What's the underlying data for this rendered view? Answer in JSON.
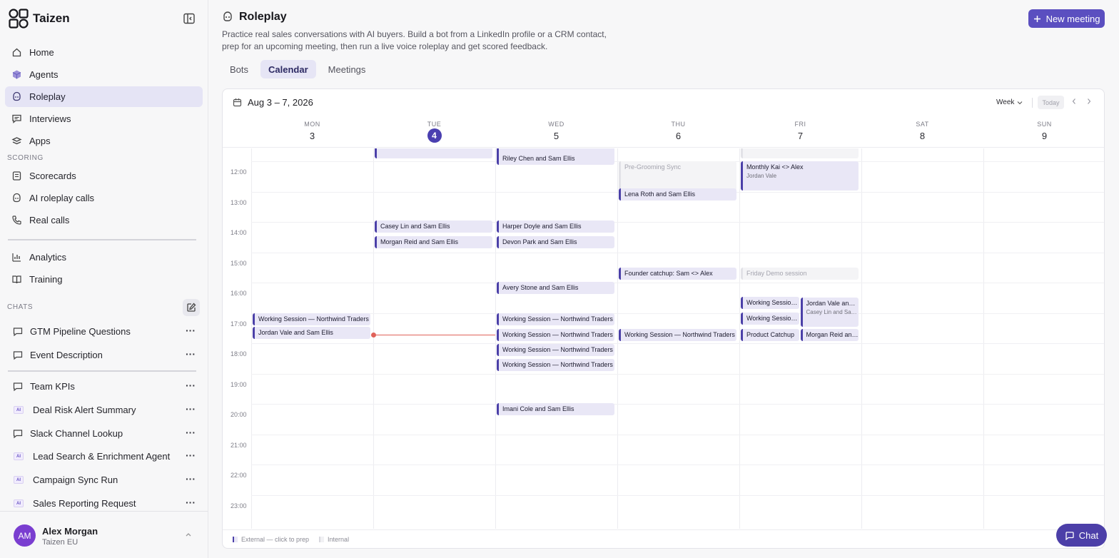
{
  "app": {
    "name": "Taizen"
  },
  "sidebar": {
    "nav": [
      {
        "label": "Home",
        "icon": "home-icon"
      },
      {
        "label": "Agents",
        "icon": "cube-icon"
      },
      {
        "label": "Roleplay",
        "icon": "roleplay-icon",
        "active": true
      },
      {
        "label": "Interviews",
        "icon": "message-icon"
      },
      {
        "label": "Apps",
        "icon": "apps-icon"
      }
    ],
    "scoring_label": "SCORING",
    "scoring": [
      {
        "label": "Scorecards",
        "icon": "scorecard-icon"
      },
      {
        "label": "AI roleplay calls",
        "icon": "ai-call-icon"
      },
      {
        "label": "Real calls",
        "icon": "phone-icon"
      }
    ],
    "tools": [
      {
        "label": "Analytics",
        "icon": "bar-chart-icon"
      },
      {
        "label": "Training",
        "icon": "training-icon"
      }
    ],
    "chats_label": "CHATS",
    "chats_top": [
      {
        "label": "GTM Pipeline Questions",
        "type": "chat"
      },
      {
        "label": "Event Description",
        "type": "chat"
      }
    ],
    "chats_bottom": [
      {
        "label": "Team KPIs",
        "type": "chat"
      },
      {
        "label": "Deal Risk Alert Summary",
        "type": "ai"
      },
      {
        "label": "Slack Channel Lookup",
        "type": "chat"
      },
      {
        "label": "Lead Search & Enrichment Agent",
        "type": "ai"
      },
      {
        "label": "Campaign Sync Run",
        "type": "ai"
      },
      {
        "label": "Sales Reporting Request",
        "type": "ai"
      }
    ],
    "ai_badge": "AI",
    "user": {
      "initials": "AM",
      "name": "Alex Morgan",
      "org": "Taizen EU"
    }
  },
  "main": {
    "title": "Roleplay",
    "description": "Practice real sales conversations with AI buyers. Build a bot from a LinkedIn profile or a CRM contact, prep for an upcoming meeting, then run a live voice roleplay and get scored feedback.",
    "new_meeting_label": "New meeting",
    "tabs": [
      {
        "label": "Bots"
      },
      {
        "label": "Calendar",
        "active": true
      },
      {
        "label": "Meetings"
      }
    ],
    "calendar": {
      "range": "Aug 3 – 7, 2026",
      "view": "Week",
      "today_label": "Today",
      "days": [
        {
          "name": "MON",
          "num": "3"
        },
        {
          "name": "TUE",
          "num": "4",
          "today": true
        },
        {
          "name": "WED",
          "num": "5"
        },
        {
          "name": "THU",
          "num": "6"
        },
        {
          "name": "FRI",
          "num": "7"
        },
        {
          "name": "SAT",
          "num": "8"
        },
        {
          "name": "SUN",
          "num": "9"
        }
      ],
      "hours": [
        "12:00",
        "13:00",
        "14:00",
        "15:00",
        "16:00",
        "17:00",
        "18:00",
        "19:00",
        "20:00",
        "21:00",
        "22:00",
        "23:00"
      ],
      "now": {
        "day": 1,
        "time": 17.72
      },
      "events": [
        {
          "day": 1,
          "start": 11.5,
          "title": "",
          "kind": "external",
          "lane": 0,
          "lanes": 1
        },
        {
          "day": 2,
          "start": 11.5,
          "title": "",
          "kind": "external",
          "lane": 0,
          "lanes": 1
        },
        {
          "day": 2,
          "start": 11.72,
          "title": "Riley Chen and Sam Ellis",
          "kind": "external",
          "lane": 0,
          "lanes": 1
        },
        {
          "day": 4,
          "start": 11.5,
          "title": "",
          "kind": "internal",
          "lane": 0,
          "lanes": 1
        },
        {
          "day": 3,
          "start": 12.0,
          "title": "Pre-Grooming Sync",
          "kind": "internal",
          "tall": true,
          "lane": 0,
          "lanes": 1
        },
        {
          "day": 4,
          "start": 12.0,
          "title": "Monthly Kai <> Alex",
          "sub": "Jordan Vale",
          "kind": "external",
          "tall": true,
          "lane": 0,
          "lanes": 1
        },
        {
          "day": 3,
          "start": 12.9,
          "title": "Lena Roth and Sam Ellis",
          "kind": "external",
          "lane": 0,
          "lanes": 1
        },
        {
          "day": 1,
          "start": 13.95,
          "title": "Casey Lin and Sam Ellis",
          "kind": "external",
          "lane": 0,
          "lanes": 1
        },
        {
          "day": 2,
          "start": 13.95,
          "title": "Harper Doyle and Sam Ellis",
          "kind": "external",
          "lane": 0,
          "lanes": 1
        },
        {
          "day": 1,
          "start": 14.47,
          "title": "Morgan Reid and Sam Ellis",
          "kind": "external",
          "lane": 0,
          "lanes": 1
        },
        {
          "day": 2,
          "start": 14.47,
          "title": "Devon Park and Sam Ellis",
          "kind": "external",
          "lane": 0,
          "lanes": 1
        },
        {
          "day": 3,
          "start": 15.5,
          "title": "Founder catchup: Sam <> Alex",
          "kind": "external",
          "lane": 0,
          "lanes": 1
        },
        {
          "day": 4,
          "start": 15.5,
          "title": "Friday Demo session",
          "kind": "internal",
          "lane": 0,
          "lanes": 1
        },
        {
          "day": 2,
          "start": 15.98,
          "title": "Avery Stone and Sam Ellis",
          "kind": "external",
          "lane": 0,
          "lanes": 1
        },
        {
          "day": 4,
          "start": 16.47,
          "title": "Working Session — Northwind Traders",
          "kind": "external",
          "lane": 0,
          "lanes": 2
        },
        {
          "day": 4,
          "start": 16.5,
          "title": "Jordan Vale and Sam Ellis",
          "sub": "Casey Lin and Sam Ellis",
          "kind": "external",
          "tall": true,
          "lane": 1,
          "lanes": 2
        },
        {
          "day": 0,
          "start": 17.02,
          "title": "Working Session — Northwind Traders",
          "kind": "external",
          "lane": 0,
          "lanes": 1
        },
        {
          "day": 2,
          "start": 17.02,
          "title": "Working Session — Northwind Traders",
          "kind": "external",
          "lane": 0,
          "lanes": 1
        },
        {
          "day": 4,
          "start": 16.98,
          "title": "Working Session — Northwind Traders",
          "kind": "external",
          "lane": 0,
          "lanes": 2
        },
        {
          "day": 0,
          "start": 17.47,
          "title": "Jordan Vale and Sam Ellis",
          "kind": "external",
          "lane": 0,
          "lanes": 1
        },
        {
          "day": 2,
          "start": 17.52,
          "title": "Working Session — Northwind Traders",
          "kind": "external",
          "lane": 0,
          "lanes": 1
        },
        {
          "day": 3,
          "start": 17.52,
          "title": "Working Session — Northwind Traders",
          "kind": "external",
          "lane": 0,
          "lanes": 1
        },
        {
          "day": 4,
          "start": 17.52,
          "title": "Product Catchup",
          "kind": "external",
          "lane": 0,
          "lanes": 2
        },
        {
          "day": 4,
          "start": 17.52,
          "title": "Morgan Reid and Sam Ellis",
          "kind": "external",
          "lane": 1,
          "lanes": 2
        },
        {
          "day": 2,
          "start": 18.02,
          "title": "Working Session — Northwind Traders",
          "kind": "external",
          "lane": 0,
          "lanes": 1
        },
        {
          "day": 2,
          "start": 18.52,
          "title": "Working Session — Northwind Traders",
          "kind": "external",
          "lane": 0,
          "lanes": 1
        },
        {
          "day": 2,
          "start": 19.98,
          "title": "Imani Cole and Sam Ellis",
          "kind": "external",
          "lane": 0,
          "lanes": 1
        }
      ],
      "legend": [
        {
          "label": "External — click to prep",
          "kind": "external"
        },
        {
          "label": "Internal",
          "kind": "internal"
        }
      ]
    }
  },
  "chat_fab_label": "Chat",
  "colors": {
    "accent": "#5b4fc0",
    "event_border": "#4b40a8",
    "event_bg": "#e9e7f6",
    "now_line": "#e0625a",
    "active_nav": "#e5e4f5"
  }
}
